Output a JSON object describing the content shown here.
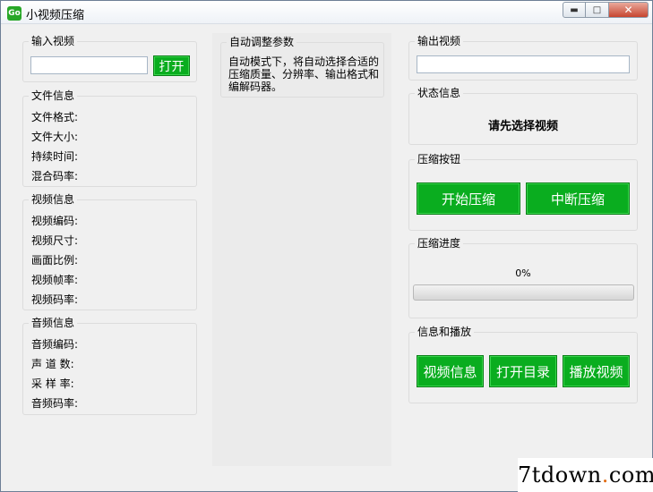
{
  "window": {
    "title": "小视频压缩",
    "icon_text": "Go"
  },
  "input_video": {
    "title": "输入视频",
    "path_value": "",
    "open_label": "打开"
  },
  "file_info": {
    "title": "文件信息",
    "format_label": "文件格式:",
    "size_label": "文件大小:",
    "duration_label": "持续时间:",
    "bitrate_label": "混合码率:"
  },
  "video_info": {
    "title": "视频信息",
    "codec_label": "视频编码:",
    "resolution_label": "视频尺寸:",
    "aspect_label": "画面比例:",
    "fps_label": "视频帧率:",
    "bitrate_label": "视频码率:"
  },
  "audio_info": {
    "title": "音频信息",
    "codec_label": "音频编码:",
    "channels_label": "声 道 数:",
    "samplerate_label": "采 样 率:",
    "bitrate_label": "音频码率:"
  },
  "auto_params": {
    "title": "自动调整参数",
    "description": "自动模式下，将自动选择合适的压缩质量、分辨率、输出格式和编解码器。"
  },
  "output_video": {
    "title": "输出视频",
    "path_value": ""
  },
  "status": {
    "title": "状态信息",
    "message": "请先选择视频"
  },
  "compress_buttons": {
    "title": "压缩按钮",
    "start_label": "开始压缩",
    "stop_label": "中断压缩"
  },
  "progress": {
    "title": "压缩进度",
    "percent_text": "0%",
    "value": 0
  },
  "info_play": {
    "title": "信息和播放",
    "video_info_label": "视频信息",
    "open_dir_label": "打开目录",
    "play_label": "播放视频"
  },
  "watermark": {
    "left": "7tdown",
    "dot": ".",
    "right": "com"
  },
  "colors": {
    "button_green": "#0aad1f",
    "progress_green": "#06b025",
    "close_red": "#c7452f"
  }
}
